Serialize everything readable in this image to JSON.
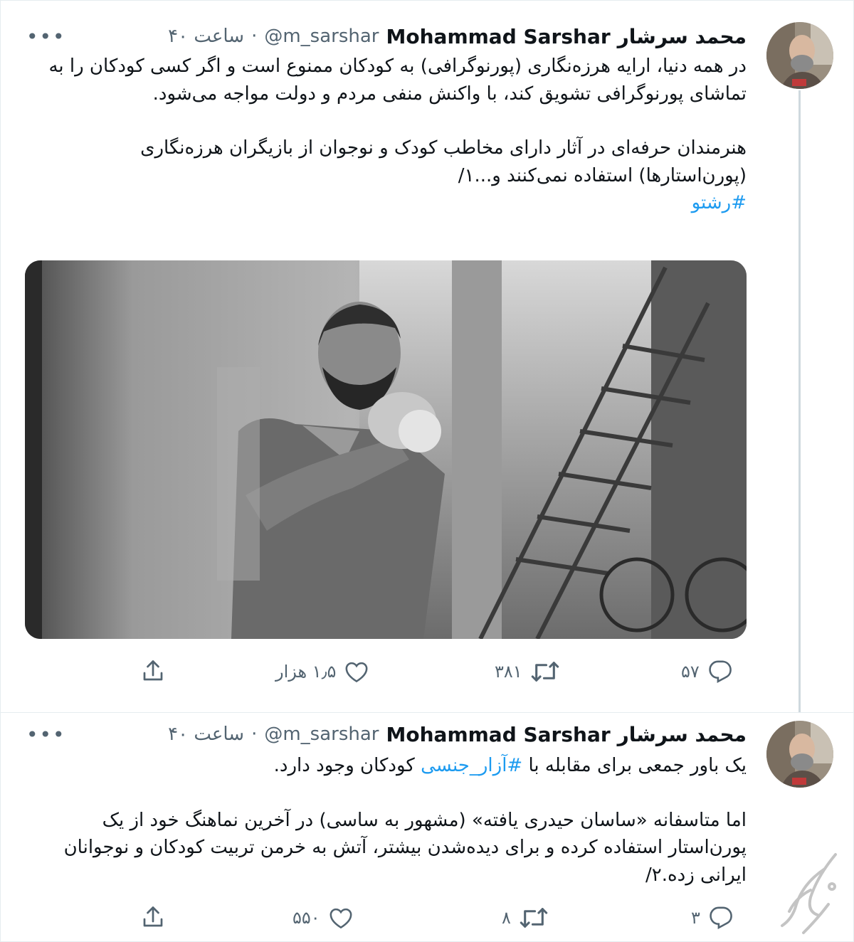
{
  "tweets": [
    {
      "display_name_fa": "محمد سرشار",
      "display_name_en": "Mohammad Sarshar",
      "handle": "@m_sarshar",
      "time": "۴۰ ساعت",
      "separator": "·",
      "paragraphs": [
        "در همه دنیا، ارایه هرزه‌نگاری (پورنوگرافی) به کودکان ممنوع است و اگر کسی کودکان را به تماشای پورنوگرافی تشویق کند، با واکنش منفی مردم و دولت مواجه می‌شود.",
        "هنرمندان حرفه‌ای در آثار دارای مخاطب کودک و نوجوان از بازیگران هرزه‌نگاری (پورن‌استارها) استفاده نمی‌کنند و...۱/"
      ],
      "hashtag": "#رشتو",
      "replies": "۵۷",
      "retweets": "۳۸۱",
      "likes": "۱٫۵ هزار"
    },
    {
      "display_name_fa": "محمد سرشار",
      "display_name_en": "Mohammad Sarshar",
      "handle": "@m_sarshar",
      "time": "۴۰ ساعت",
      "separator": "·",
      "line1_before": "یک باور جمعی برای مقابله با ",
      "line1_hashtag": "#آزار_جنسی",
      "line1_after": " کودکان وجود دارد.",
      "paragraph2": "اما متاسفانه «ساسان حیدری یافته» (مشهور به ساسی) در آخرین نماهنگ خود از یک پورن‌استار استفاده کرده و برای دیده‌شدن بیشتر، آتش به خرمن تربیت کودکان و نوجوانان ایرانی زده.۲/",
      "replies": "۳",
      "retweets": "۸",
      "likes": "۵۵۰"
    }
  ],
  "more_icon": "•••",
  "icons": {
    "reply": "reply-icon",
    "retweet": "retweet-icon",
    "like": "heart-icon",
    "share": "share-icon"
  },
  "colors": {
    "link": "#1d9bf0",
    "muted": "#536471",
    "text": "#0f1419",
    "thread_line": "#cfd9de"
  }
}
